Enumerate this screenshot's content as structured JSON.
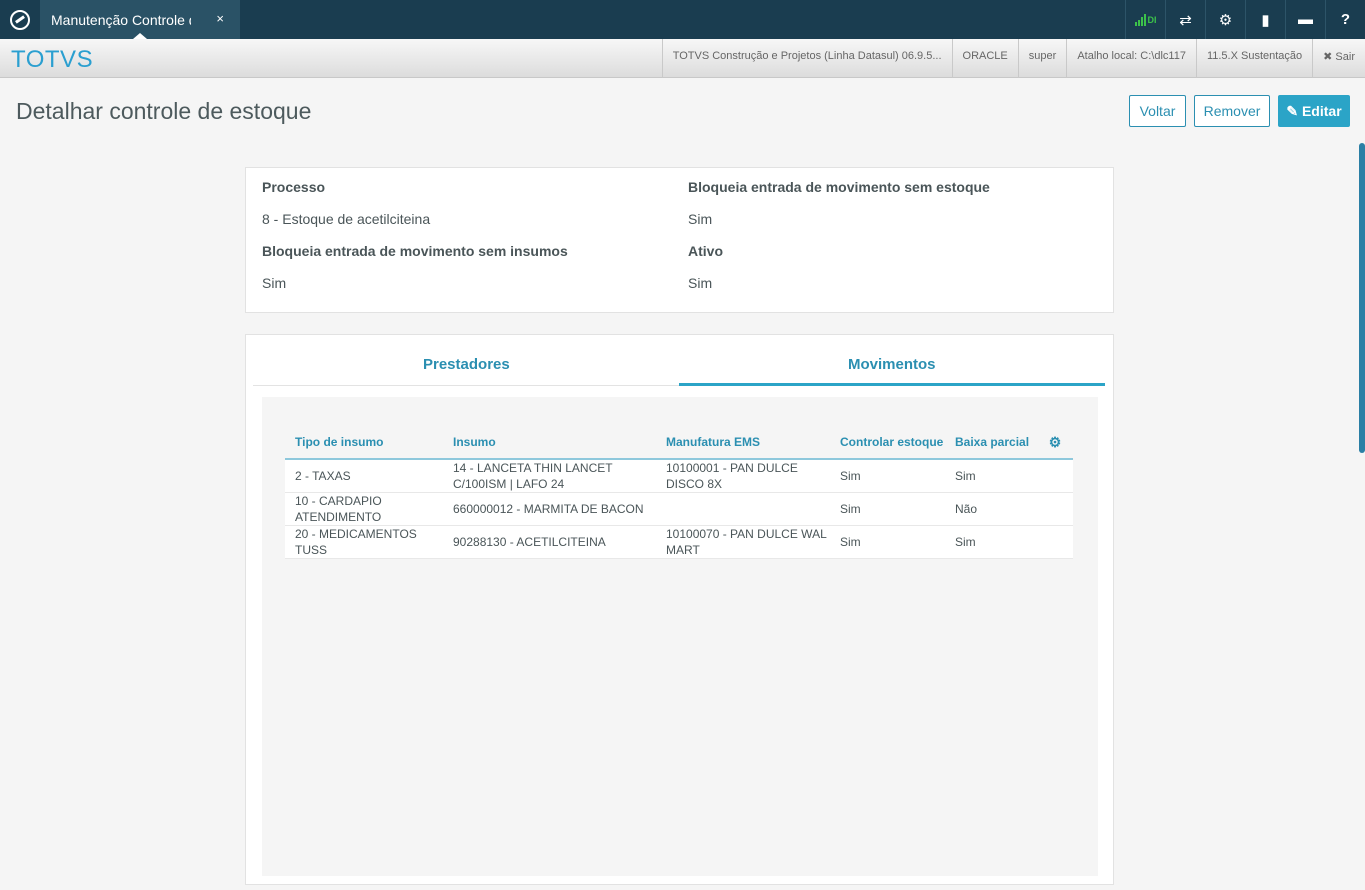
{
  "topbar": {
    "tab_label": "Manutenção Controle de Estoque",
    "tab_close": "×",
    "signal_text": "DI",
    "icons": [
      "shuffle-icon",
      "gear-icon",
      "document-icon",
      "chat-icon",
      "help-icon"
    ],
    "icon_glyphs": [
      "⇄",
      "⚙",
      "▮",
      "▬",
      "?"
    ]
  },
  "subbar": {
    "brand": "TOTVS",
    "items": [
      "TOTVS Construção e Projetos (Linha Datasul) 06.9.5...",
      "ORACLE",
      "super",
      "Atalho local: C:\\dlc117",
      "11.5.X Sustentação",
      "✖ Sair"
    ]
  },
  "page": {
    "title": "Detalhar controle de estoque",
    "buttons": {
      "back": "Voltar",
      "remove": "Remover",
      "edit": "✎ Editar"
    }
  },
  "details": {
    "processo_label": "Processo",
    "processo_value": "8 - Estoque de acetilciteina",
    "bloqueia_estoque_label": "Bloqueia entrada de movimento sem estoque",
    "bloqueia_estoque_value": "Sim",
    "bloqueia_insumos_label": "Bloqueia entrada de movimento sem insumos",
    "bloqueia_insumos_value": "Sim",
    "ativo_label": "Ativo",
    "ativo_value": "Sim"
  },
  "tabs": {
    "prestadores": "Prestadores",
    "movimentos": "Movimentos"
  },
  "grid": {
    "headers": [
      "Tipo de insumo",
      "Insumo",
      "Manufatura EMS",
      "Controlar estoque",
      "Baixa parcial"
    ],
    "gear": "⚙",
    "rows": [
      [
        "2 - TAXAS",
        "14 - LANCETA THIN LANCET C/100ISM | LAFO 24",
        "10100001 - PAN DULCE DISCO 8X",
        "Sim",
        "Sim"
      ],
      [
        "10 - CARDAPIO ATENDIMENTO",
        "660000012 - MARMITA DE BACON",
        "",
        "Sim",
        "Não"
      ],
      [
        "20 - MEDICAMENTOS TUSS",
        "90288130 - ACETILCITEINA",
        "10100070 - PAN DULCE WAL MART",
        "Sim",
        "Sim"
      ]
    ]
  },
  "colors": {
    "accent": "#2ba4c7",
    "topbar": "#1a3d50",
    "brand": "#2a9fd0",
    "signal": "#3cc24a"
  }
}
